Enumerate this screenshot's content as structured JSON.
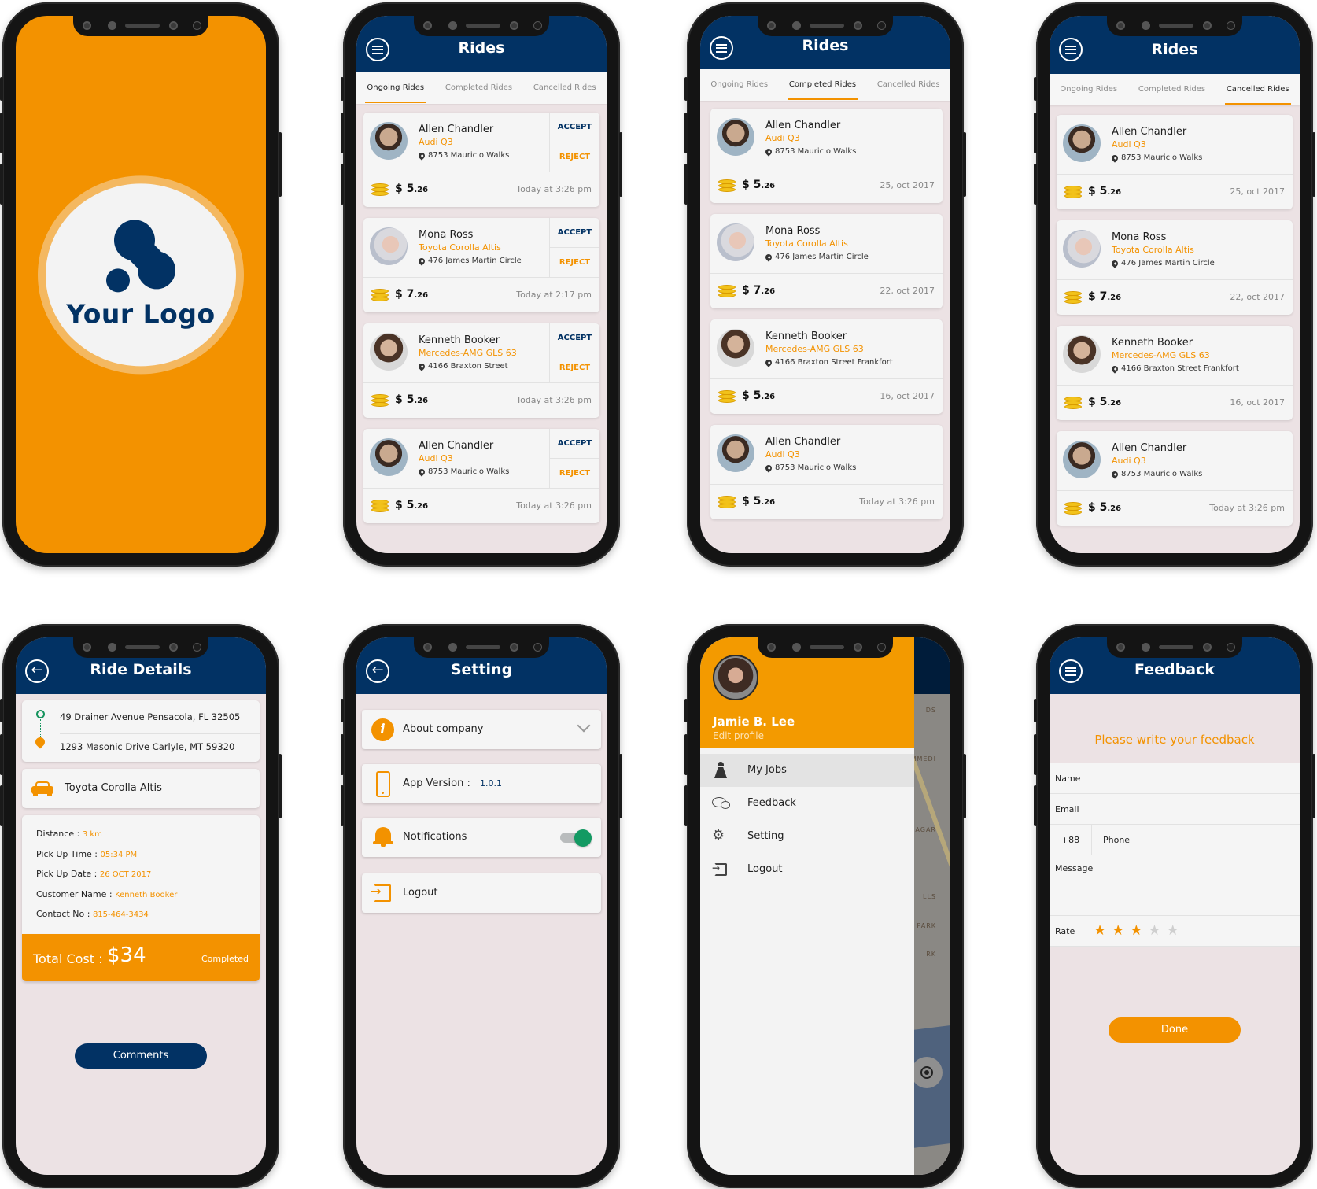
{
  "colors": {
    "brand_navy": "#023264",
    "brand_orange": "#f39200",
    "toggle_on": "#139a63",
    "screen_bg": "#ece2e4"
  },
  "splash": {
    "logo_text": "Your Logo"
  },
  "rides_common": {
    "title": "Rides",
    "tabs": [
      "Ongoing Rides",
      "Completed Rides",
      "Cancelled Rides"
    ],
    "accept_label": "ACCEPT",
    "reject_label": "REJECT",
    "currency": "$"
  },
  "ongoing": {
    "active_tab": "Ongoing Rides",
    "rides": [
      {
        "name": "Allen Chandler",
        "car": "Audi Q3",
        "address": "8753 Mauricio Walks",
        "price_main": "5",
        "price_cents": ".26",
        "when": "Today at 3:26 pm"
      },
      {
        "name": "Mona Ross",
        "car": "Toyota Corolla Altis",
        "address": "476 James Martin Circle",
        "price_main": "7",
        "price_cents": ".26",
        "when": "Today at 2:17 pm"
      },
      {
        "name": "Kenneth Booker",
        "car": "Mercedes-AMG GLS 63",
        "address": "4166 Braxton Street",
        "price_main": "5",
        "price_cents": ".26",
        "when": "Today at 3:26 pm"
      },
      {
        "name": "Allen Chandler",
        "car": "Audi Q3",
        "address": "8753 Mauricio Walks",
        "price_main": "5",
        "price_cents": ".26",
        "when": "Today at 3:26 pm"
      }
    ]
  },
  "completed": {
    "active_tab": "Completed Rides",
    "rides": [
      {
        "name": "Allen Chandler",
        "car": "Audi Q3",
        "address": "8753 Mauricio Walks",
        "price_main": "5",
        "price_cents": ".26",
        "when": "25, oct 2017"
      },
      {
        "name": "Mona Ross",
        "car": "Toyota Corolla Altis",
        "address": "476 James Martin Circle",
        "price_main": "7",
        "price_cents": ".26",
        "when": "22, oct 2017"
      },
      {
        "name": "Kenneth Booker",
        "car": "Mercedes-AMG GLS 63",
        "address": "4166 Braxton Street Frankfort",
        "price_main": "5",
        "price_cents": ".26",
        "when": "16, oct 2017"
      },
      {
        "name": "Allen Chandler",
        "car": "Audi Q3",
        "address": "8753 Mauricio Walks",
        "price_main": "5",
        "price_cents": ".26",
        "when": "Today at 3:26 pm"
      }
    ]
  },
  "cancelled": {
    "active_tab": "Cancelled Rides",
    "rides": [
      {
        "name": "Allen Chandler",
        "car": "Audi Q3",
        "address": "8753 Mauricio Walks",
        "price_main": "5",
        "price_cents": ".26",
        "when": "25, oct 2017"
      },
      {
        "name": "Mona Ross",
        "car": "Toyota Corolla Altis",
        "address": "476 James Martin Circle",
        "price_main": "7",
        "price_cents": ".26",
        "when": "22, oct 2017"
      },
      {
        "name": "Kenneth Booker",
        "car": "Mercedes-AMG GLS 63",
        "address": "4166 Braxton Street Frankfort",
        "price_main": "5",
        "price_cents": ".26",
        "when": "16, oct 2017"
      },
      {
        "name": "Allen Chandler",
        "car": "Audi Q3",
        "address": "8753 Mauricio Walks",
        "price_main": "5",
        "price_cents": ".26",
        "when": "Today at 3:26 pm"
      }
    ]
  },
  "ride_details": {
    "title": "Ride Details",
    "pickup": "49 Drainer Avenue Pensacola, FL 32505",
    "dropoff": "1293 Masonic Drive Carlyle, MT 59320",
    "car": "Toyota Corolla Altis",
    "info": [
      {
        "label": "Distance : ",
        "value": "3 km"
      },
      {
        "label": "Pick Up Time : ",
        "value": "05:34 PM"
      },
      {
        "label": "Pick Up Date : ",
        "value": "26 OCT 2017"
      },
      {
        "label": "Customer Name : ",
        "value": "Kenneth Booker"
      },
      {
        "label": "Contact No : ",
        "value": "815-464-3434"
      }
    ],
    "total_label": "Total Cost : ",
    "total_amount": "$34",
    "status": "Completed",
    "comments_button": "Comments"
  },
  "settings": {
    "title": "Setting",
    "about": "About company",
    "version_label": "App Version : ",
    "version_value": "1.0.1",
    "notifications": "Notifications",
    "notifications_on": true,
    "logout": "Logout"
  },
  "drawer": {
    "user_name": "Jamie B. Lee",
    "edit_profile": "Edit profile",
    "items": [
      {
        "label": "My Jobs",
        "icon": "driver-icon",
        "selected": true
      },
      {
        "label": "Feedback",
        "icon": "chat-icon",
        "selected": false
      },
      {
        "label": "Setting",
        "icon": "gear-icon",
        "selected": false
      },
      {
        "label": "Logout",
        "icon": "logout-icon",
        "selected": false
      }
    ],
    "map_labels": [
      "DS",
      "MMEDI",
      "IT NAGAR",
      "LLS",
      "PARK",
      "RK"
    ]
  },
  "feedback": {
    "title": "Feedback",
    "prompt": "Please write your feedback",
    "name_placeholder": "Name",
    "email_placeholder": "Email",
    "country_code": "+88",
    "phone_placeholder": "Phone",
    "message_placeholder": "Message",
    "rate_label": "Rate",
    "rating": 3,
    "rating_max": 5,
    "star_glyph": "★",
    "done_button": "Done"
  }
}
